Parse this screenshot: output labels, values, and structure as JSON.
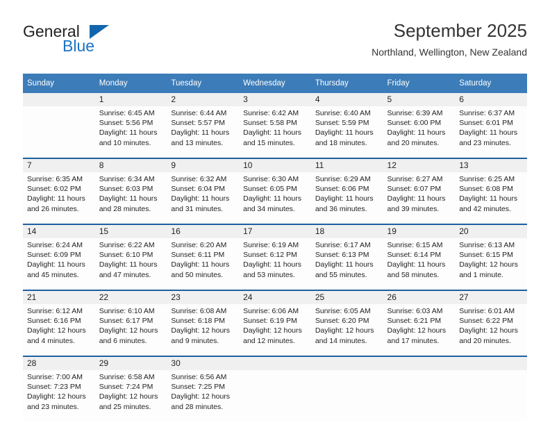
{
  "brand": {
    "name_part1": "General",
    "name_part2": "Blue",
    "triangle_icon": "blue-triangle-icon"
  },
  "header": {
    "title": "September 2025",
    "subtitle": "Northland, Wellington, New Zealand"
  },
  "colors": {
    "header_blue": "#3c7cb8",
    "separator_blue": "#1f5fa0",
    "brand_blue": "#1c72c4",
    "daynum_band": "#f0f0f0"
  },
  "weekday_headers": [
    "Sunday",
    "Monday",
    "Tuesday",
    "Wednesday",
    "Thursday",
    "Friday",
    "Saturday"
  ],
  "labels": {
    "sunrise_prefix": "Sunrise:",
    "sunset_prefix": "Sunset:",
    "daylight_prefix": "Daylight:"
  },
  "weeks": [
    [
      {
        "day": "",
        "lines": [
          "",
          "",
          "",
          ""
        ]
      },
      {
        "day": "1",
        "lines": [
          "Sunrise: 6:45 AM",
          "Sunset: 5:56 PM",
          "Daylight: 11 hours",
          "and 10 minutes."
        ]
      },
      {
        "day": "2",
        "lines": [
          "Sunrise: 6:44 AM",
          "Sunset: 5:57 PM",
          "Daylight: 11 hours",
          "and 13 minutes."
        ]
      },
      {
        "day": "3",
        "lines": [
          "Sunrise: 6:42 AM",
          "Sunset: 5:58 PM",
          "Daylight: 11 hours",
          "and 15 minutes."
        ]
      },
      {
        "day": "4",
        "lines": [
          "Sunrise: 6:40 AM",
          "Sunset: 5:59 PM",
          "Daylight: 11 hours",
          "and 18 minutes."
        ]
      },
      {
        "day": "5",
        "lines": [
          "Sunrise: 6:39 AM",
          "Sunset: 6:00 PM",
          "Daylight: 11 hours",
          "and 20 minutes."
        ]
      },
      {
        "day": "6",
        "lines": [
          "Sunrise: 6:37 AM",
          "Sunset: 6:01 PM",
          "Daylight: 11 hours",
          "and 23 minutes."
        ]
      }
    ],
    [
      {
        "day": "7",
        "lines": [
          "Sunrise: 6:35 AM",
          "Sunset: 6:02 PM",
          "Daylight: 11 hours",
          "and 26 minutes."
        ]
      },
      {
        "day": "8",
        "lines": [
          "Sunrise: 6:34 AM",
          "Sunset: 6:03 PM",
          "Daylight: 11 hours",
          "and 28 minutes."
        ]
      },
      {
        "day": "9",
        "lines": [
          "Sunrise: 6:32 AM",
          "Sunset: 6:04 PM",
          "Daylight: 11 hours",
          "and 31 minutes."
        ]
      },
      {
        "day": "10",
        "lines": [
          "Sunrise: 6:30 AM",
          "Sunset: 6:05 PM",
          "Daylight: 11 hours",
          "and 34 minutes."
        ]
      },
      {
        "day": "11",
        "lines": [
          "Sunrise: 6:29 AM",
          "Sunset: 6:06 PM",
          "Daylight: 11 hours",
          "and 36 minutes."
        ]
      },
      {
        "day": "12",
        "lines": [
          "Sunrise: 6:27 AM",
          "Sunset: 6:07 PM",
          "Daylight: 11 hours",
          "and 39 minutes."
        ]
      },
      {
        "day": "13",
        "lines": [
          "Sunrise: 6:25 AM",
          "Sunset: 6:08 PM",
          "Daylight: 11 hours",
          "and 42 minutes."
        ]
      }
    ],
    [
      {
        "day": "14",
        "lines": [
          "Sunrise: 6:24 AM",
          "Sunset: 6:09 PM",
          "Daylight: 11 hours",
          "and 45 minutes."
        ]
      },
      {
        "day": "15",
        "lines": [
          "Sunrise: 6:22 AM",
          "Sunset: 6:10 PM",
          "Daylight: 11 hours",
          "and 47 minutes."
        ]
      },
      {
        "day": "16",
        "lines": [
          "Sunrise: 6:20 AM",
          "Sunset: 6:11 PM",
          "Daylight: 11 hours",
          "and 50 minutes."
        ]
      },
      {
        "day": "17",
        "lines": [
          "Sunrise: 6:19 AM",
          "Sunset: 6:12 PM",
          "Daylight: 11 hours",
          "and 53 minutes."
        ]
      },
      {
        "day": "18",
        "lines": [
          "Sunrise: 6:17 AM",
          "Sunset: 6:13 PM",
          "Daylight: 11 hours",
          "and 55 minutes."
        ]
      },
      {
        "day": "19",
        "lines": [
          "Sunrise: 6:15 AM",
          "Sunset: 6:14 PM",
          "Daylight: 11 hours",
          "and 58 minutes."
        ]
      },
      {
        "day": "20",
        "lines": [
          "Sunrise: 6:13 AM",
          "Sunset: 6:15 PM",
          "Daylight: 12 hours",
          "and 1 minute."
        ]
      }
    ],
    [
      {
        "day": "21",
        "lines": [
          "Sunrise: 6:12 AM",
          "Sunset: 6:16 PM",
          "Daylight: 12 hours",
          "and 4 minutes."
        ]
      },
      {
        "day": "22",
        "lines": [
          "Sunrise: 6:10 AM",
          "Sunset: 6:17 PM",
          "Daylight: 12 hours",
          "and 6 minutes."
        ]
      },
      {
        "day": "23",
        "lines": [
          "Sunrise: 6:08 AM",
          "Sunset: 6:18 PM",
          "Daylight: 12 hours",
          "and 9 minutes."
        ]
      },
      {
        "day": "24",
        "lines": [
          "Sunrise: 6:06 AM",
          "Sunset: 6:19 PM",
          "Daylight: 12 hours",
          "and 12 minutes."
        ]
      },
      {
        "day": "25",
        "lines": [
          "Sunrise: 6:05 AM",
          "Sunset: 6:20 PM",
          "Daylight: 12 hours",
          "and 14 minutes."
        ]
      },
      {
        "day": "26",
        "lines": [
          "Sunrise: 6:03 AM",
          "Sunset: 6:21 PM",
          "Daylight: 12 hours",
          "and 17 minutes."
        ]
      },
      {
        "day": "27",
        "lines": [
          "Sunrise: 6:01 AM",
          "Sunset: 6:22 PM",
          "Daylight: 12 hours",
          "and 20 minutes."
        ]
      }
    ],
    [
      {
        "day": "28",
        "lines": [
          "Sunrise: 7:00 AM",
          "Sunset: 7:23 PM",
          "Daylight: 12 hours",
          "and 23 minutes."
        ]
      },
      {
        "day": "29",
        "lines": [
          "Sunrise: 6:58 AM",
          "Sunset: 7:24 PM",
          "Daylight: 12 hours",
          "and 25 minutes."
        ]
      },
      {
        "day": "30",
        "lines": [
          "Sunrise: 6:56 AM",
          "Sunset: 7:25 PM",
          "Daylight: 12 hours",
          "and 28 minutes."
        ]
      },
      {
        "day": "",
        "lines": [
          "",
          "",
          "",
          ""
        ]
      },
      {
        "day": "",
        "lines": [
          "",
          "",
          "",
          ""
        ]
      },
      {
        "day": "",
        "lines": [
          "",
          "",
          "",
          ""
        ]
      },
      {
        "day": "",
        "lines": [
          "",
          "",
          "",
          ""
        ]
      }
    ]
  ]
}
